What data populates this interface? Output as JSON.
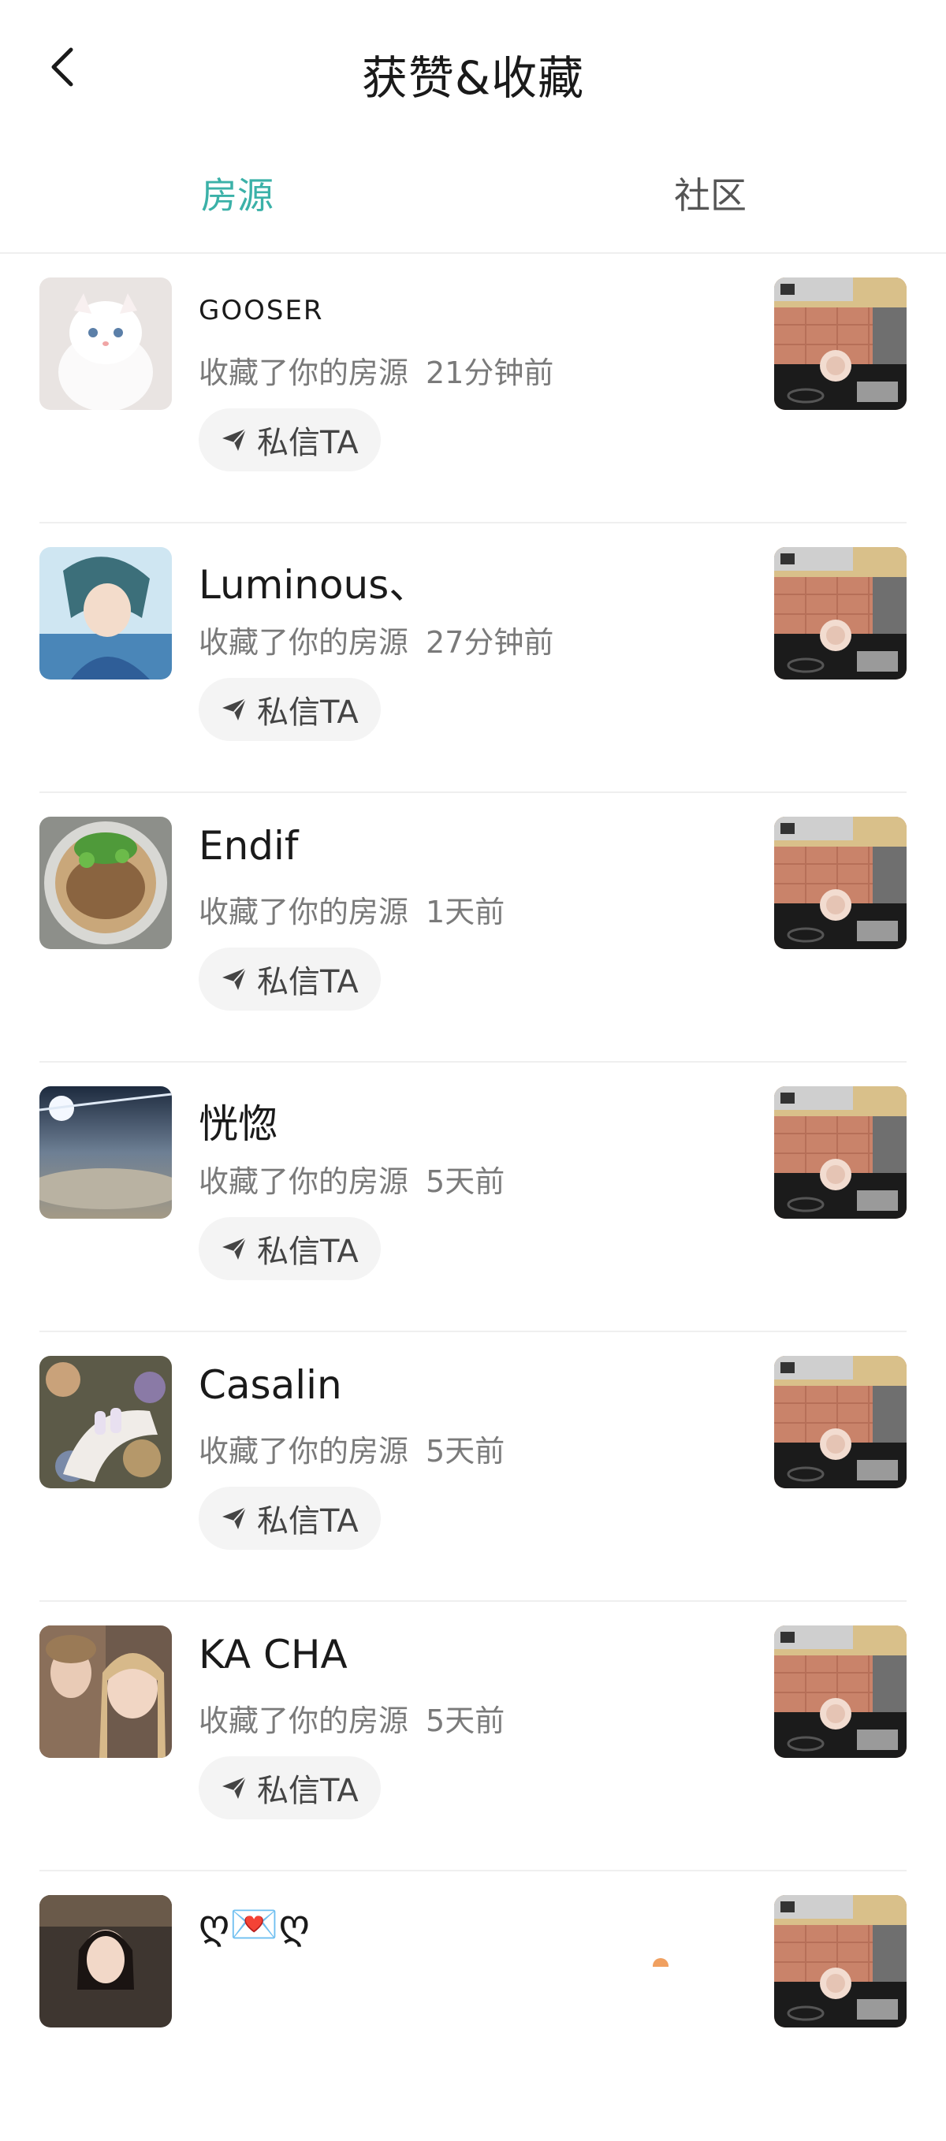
{
  "header": {
    "title": "获赞&收藏",
    "back_icon": "chevron-left-icon"
  },
  "tabs": [
    {
      "label": "房源",
      "active": true
    },
    {
      "label": "社区",
      "active": false
    }
  ],
  "colors": {
    "accent": "#3bb1a8",
    "muted_text": "#7a7a7a",
    "button_bg": "#f4f4f4"
  },
  "button_icon": "send-icon",
  "items": [
    {
      "name": "GOOSER",
      "action": "收藏了你的房源",
      "time": "21分钟前",
      "button": "私信TA",
      "avatar": "white-kitten"
    },
    {
      "name": "Luminous、",
      "action": "收藏了你的房源",
      "time": "27分钟前",
      "button": "私信TA",
      "avatar": "anime-boy"
    },
    {
      "name": "Endif",
      "action": "收藏了你的房源",
      "time": "1天前",
      "button": "私信TA",
      "avatar": "noodle-bowl"
    },
    {
      "name": "恍惚",
      "action": "收藏了你的房源",
      "time": "5天前",
      "button": "私信TA",
      "avatar": "sky-clouds"
    },
    {
      "name": "Casalin",
      "action": "收藏了你的房源",
      "time": "5天前",
      "button": "私信TA",
      "avatar": "hand-flowers"
    },
    {
      "name": "KA  CHA",
      "action": "收藏了你的房源",
      "time": "5天前",
      "button": "私信TA",
      "avatar": "two-girls"
    },
    {
      "name": "ღ💌ღ",
      "avatar": "girl-portrait"
    }
  ]
}
